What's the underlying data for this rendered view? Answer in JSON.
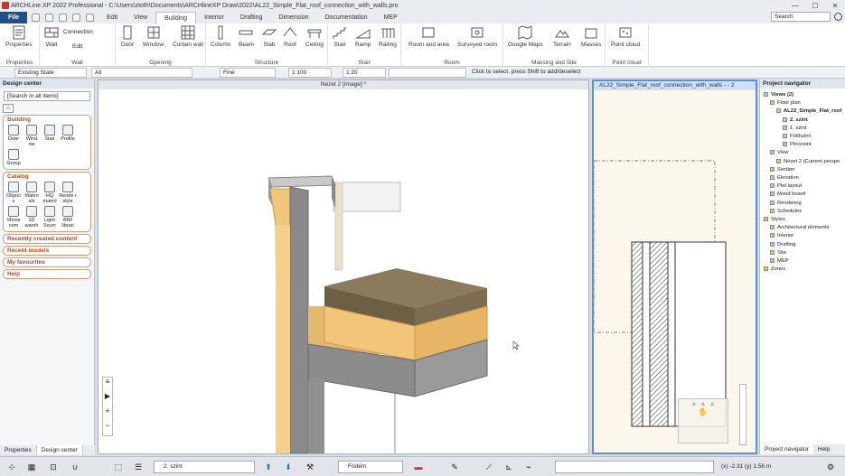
{
  "window": {
    "title": "ARCHLine.XP 2022  Professional - C:\\Users\\ztoth\\Documents\\ARCHlineXP Draw\\2022\\AL22_Simple_Flat_roof_connection_with_walls.pro",
    "minimize": "—",
    "maximize": "☐",
    "close": "✕"
  },
  "tabs": [
    "File",
    "Edit",
    "View",
    "Building",
    "Interior",
    "Drafting",
    "Dimension",
    "Documentation",
    "MEP"
  ],
  "active_tab": "Building",
  "search_placeholder": "Search",
  "ribbon": {
    "groups": {
      "properties": "Properties",
      "wall": "Wall",
      "opening": "Opening",
      "structure": "Structure",
      "stair": "Stair",
      "room": "Room",
      "massing": "Massing and Site",
      "pointcloud": "Point cloud"
    },
    "buttons": {
      "properties": "Properties",
      "wall": "Wall",
      "connection": "Connection",
      "edit": "Edit",
      "door": "Door",
      "window": "Window",
      "curtain_wall": "Curtain wall",
      "column": "Column",
      "beam": "Beam",
      "slab": "Slab",
      "roof": "Roof",
      "ceiling": "Ceiling",
      "stair": "Stair",
      "ramp": "Ramp",
      "railing": "Railing",
      "room_and_area": "Room and area",
      "surveyed_room": "Surveyed room",
      "google_maps": "Google Maps",
      "terrain": "Terrain",
      "masses": "Masses",
      "point_cloud": "Point cloud"
    }
  },
  "options_bar": {
    "state": "Existing State",
    "layer": "All",
    "line": "Fine",
    "scale1": "1:100",
    "scale2": "1:20",
    "hint": "Click to select, press Shift to add/deselect"
  },
  "design_center": {
    "title": "Design center",
    "search": "[Search in all items]",
    "building_header": "Building",
    "building_items": [
      "Door",
      "Wind ow",
      "Stair",
      "Profile",
      "Group"
    ],
    "catalog_header": "Catalog",
    "catalog_items": [
      "Object s",
      "Materi als",
      "HQ materi",
      "Rende r style",
      "Showr oom",
      "3D wareh",
      "Light Sourc",
      "BIM librari"
    ],
    "links": [
      "Recently created content",
      "Recent models",
      "My favourites",
      "Help"
    ]
  },
  "view1": {
    "title": "Nézet 2 [Image] *"
  },
  "view2": {
    "title": "AL22_Simple_Flat_roof_connection_with_walls - - 2"
  },
  "project_navigator": {
    "title": "Project navigator",
    "items": [
      {
        "label": "Views (2)",
        "indent": 0,
        "bold": true
      },
      {
        "label": "Floor plan",
        "indent": 1
      },
      {
        "label": "AL22_Simple_Flat_roof_",
        "indent": 2,
        "bold": true
      },
      {
        "label": "2. szint",
        "indent": 3,
        "bold": true
      },
      {
        "label": "1. szint",
        "indent": 3
      },
      {
        "label": "Földszint",
        "indent": 3
      },
      {
        "label": "Pincesint",
        "indent": 3
      },
      {
        "label": "View",
        "indent": 1
      },
      {
        "label": "Nézet 2 (Current perspe",
        "indent": 2
      },
      {
        "label": "Section",
        "indent": 1
      },
      {
        "label": "Elevation",
        "indent": 1
      },
      {
        "label": "Plot layout",
        "indent": 1
      },
      {
        "label": "Mood board",
        "indent": 1
      },
      {
        "label": "Rendering",
        "indent": 1
      },
      {
        "label": "Schedules",
        "indent": 1
      },
      {
        "label": "Styles",
        "indent": 0
      },
      {
        "label": "Architectural elements",
        "indent": 1
      },
      {
        "label": "Interior",
        "indent": 1
      },
      {
        "label": "Drafting",
        "indent": 1
      },
      {
        "label": "Site",
        "indent": 1
      },
      {
        "label": "MEP",
        "indent": 1
      },
      {
        "label": "Zones",
        "indent": 0
      }
    ]
  },
  "bottom_tabs_left": [
    "Properties",
    "Design center"
  ],
  "bottom_tabs_right": [
    "Project navigator",
    "Help"
  ],
  "status": {
    "floor": "2. szint",
    "layer": "Födém",
    "coords": "(x) -2.31  (y) 1.56 m"
  }
}
